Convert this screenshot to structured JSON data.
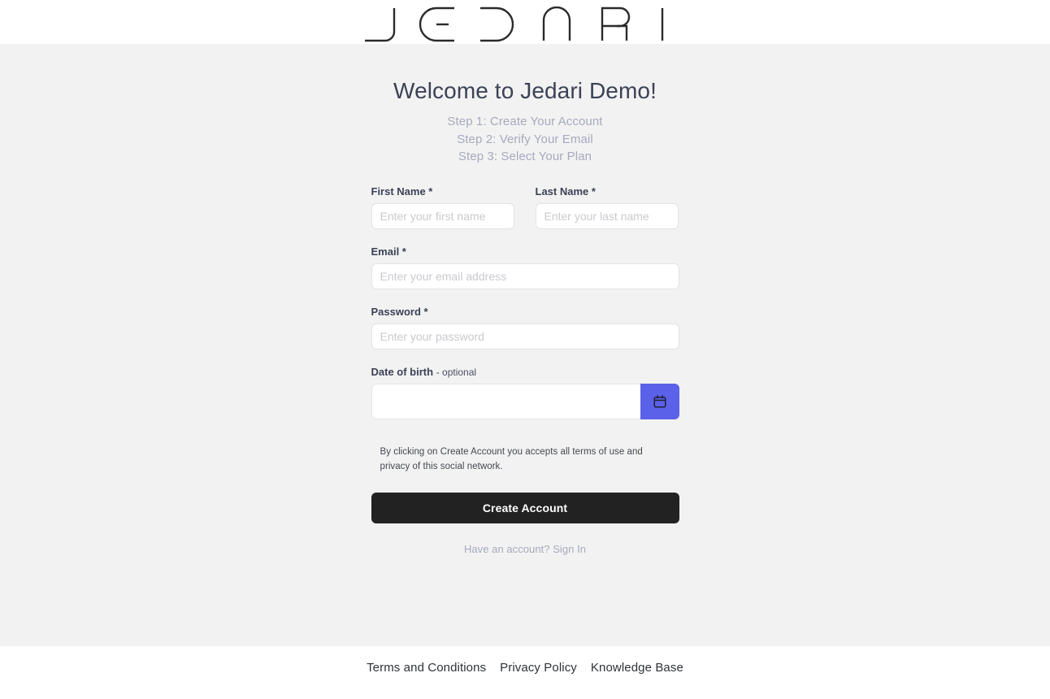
{
  "header": {
    "logo_text": "JEDARI",
    "logo_name": "jedari-logo"
  },
  "main": {
    "title": "Welcome to Jedari Demo!",
    "steps": [
      "Step 1: Create Your Account",
      "Step 2: Verify Your Email",
      "Step 3: Select Your Plan"
    ],
    "form": {
      "first_name": {
        "label": "First Name *",
        "placeholder": "Enter your first name",
        "value": ""
      },
      "last_name": {
        "label": "Last Name *",
        "placeholder": "Enter your last name",
        "value": ""
      },
      "email": {
        "label": "Email *",
        "placeholder": "Enter your email address",
        "value": ""
      },
      "password": {
        "label": "Password *",
        "placeholder": "Enter your password",
        "value": ""
      },
      "date_of_birth": {
        "label": "Date of birth",
        "label_optional": "- optional",
        "placeholder": "",
        "value": "",
        "calendar_icon": "calendar-icon"
      },
      "terms_text": "By clicking on Create Account you accepts all terms of use and privacy of this social network.",
      "submit_label": "Create Account",
      "signin_text": "Have an account? Sign In"
    }
  },
  "footer": {
    "links": [
      "Terms and Conditions",
      "Privacy Policy",
      "Knowledge Base"
    ]
  },
  "colors": {
    "page_background": "#f2f2f2",
    "surface": "#ffffff",
    "accent_purple": "#5b61e8",
    "button_dark": "#222222",
    "text_dark": "#3c4257",
    "text_muted": "#a6aabe",
    "border": "#e3e3e6"
  }
}
